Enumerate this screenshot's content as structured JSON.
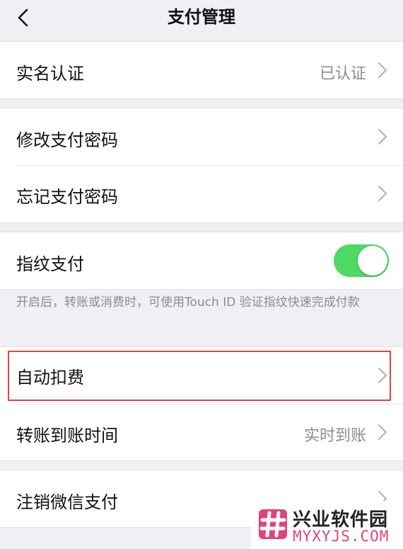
{
  "nav": {
    "title": "支付管理"
  },
  "groups": {
    "identity": {
      "label": "实名认证",
      "value": "已认证"
    },
    "password": {
      "change": "修改支付密码",
      "forgot": "忘记支付密码"
    },
    "fingerprint": {
      "label": "指纹支付",
      "enabled": true,
      "note": "开启后，转账或消费时，可使用Touch ID 验证指纹快速完成付款"
    },
    "payments": {
      "auto_deduct": "自动扣费",
      "transfer_time": "转账到账时间",
      "transfer_time_value": "实时到账"
    },
    "deregister": {
      "label": "注销微信支付"
    }
  },
  "watermark": {
    "title": "兴业软件园",
    "url": "MYXYJS.COM"
  },
  "colors": {
    "toggle_on": "#4cd964",
    "highlight": "#e04444",
    "watermark_pink": "#e0447a"
  }
}
